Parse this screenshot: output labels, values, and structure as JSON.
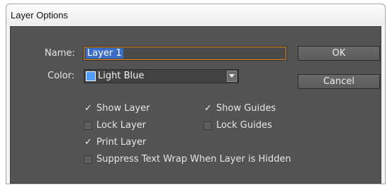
{
  "window": {
    "title": "Layer Options"
  },
  "form": {
    "name_label": "Name:",
    "name_value": "Layer 1",
    "color_label": "Color:",
    "color_value": "Light Blue",
    "swatch_color": "#4f9dff",
    "accent_focus_color": "#e08a1e"
  },
  "buttons": {
    "ok": "OK",
    "cancel": "Cancel"
  },
  "options": {
    "show_layer": {
      "label": "Show Layer",
      "checked": true
    },
    "show_guides": {
      "label": "Show Guides",
      "checked": true
    },
    "lock_layer": {
      "label": "Lock Layer",
      "checked": false
    },
    "lock_guides": {
      "label": "Lock Guides",
      "checked": false
    },
    "print_layer": {
      "label": "Print Layer",
      "checked": true
    },
    "suppress_text_wrap": {
      "label": "Suppress Text Wrap When Layer is Hidden",
      "checked": false
    }
  },
  "glyphs": {
    "check": "✓"
  }
}
